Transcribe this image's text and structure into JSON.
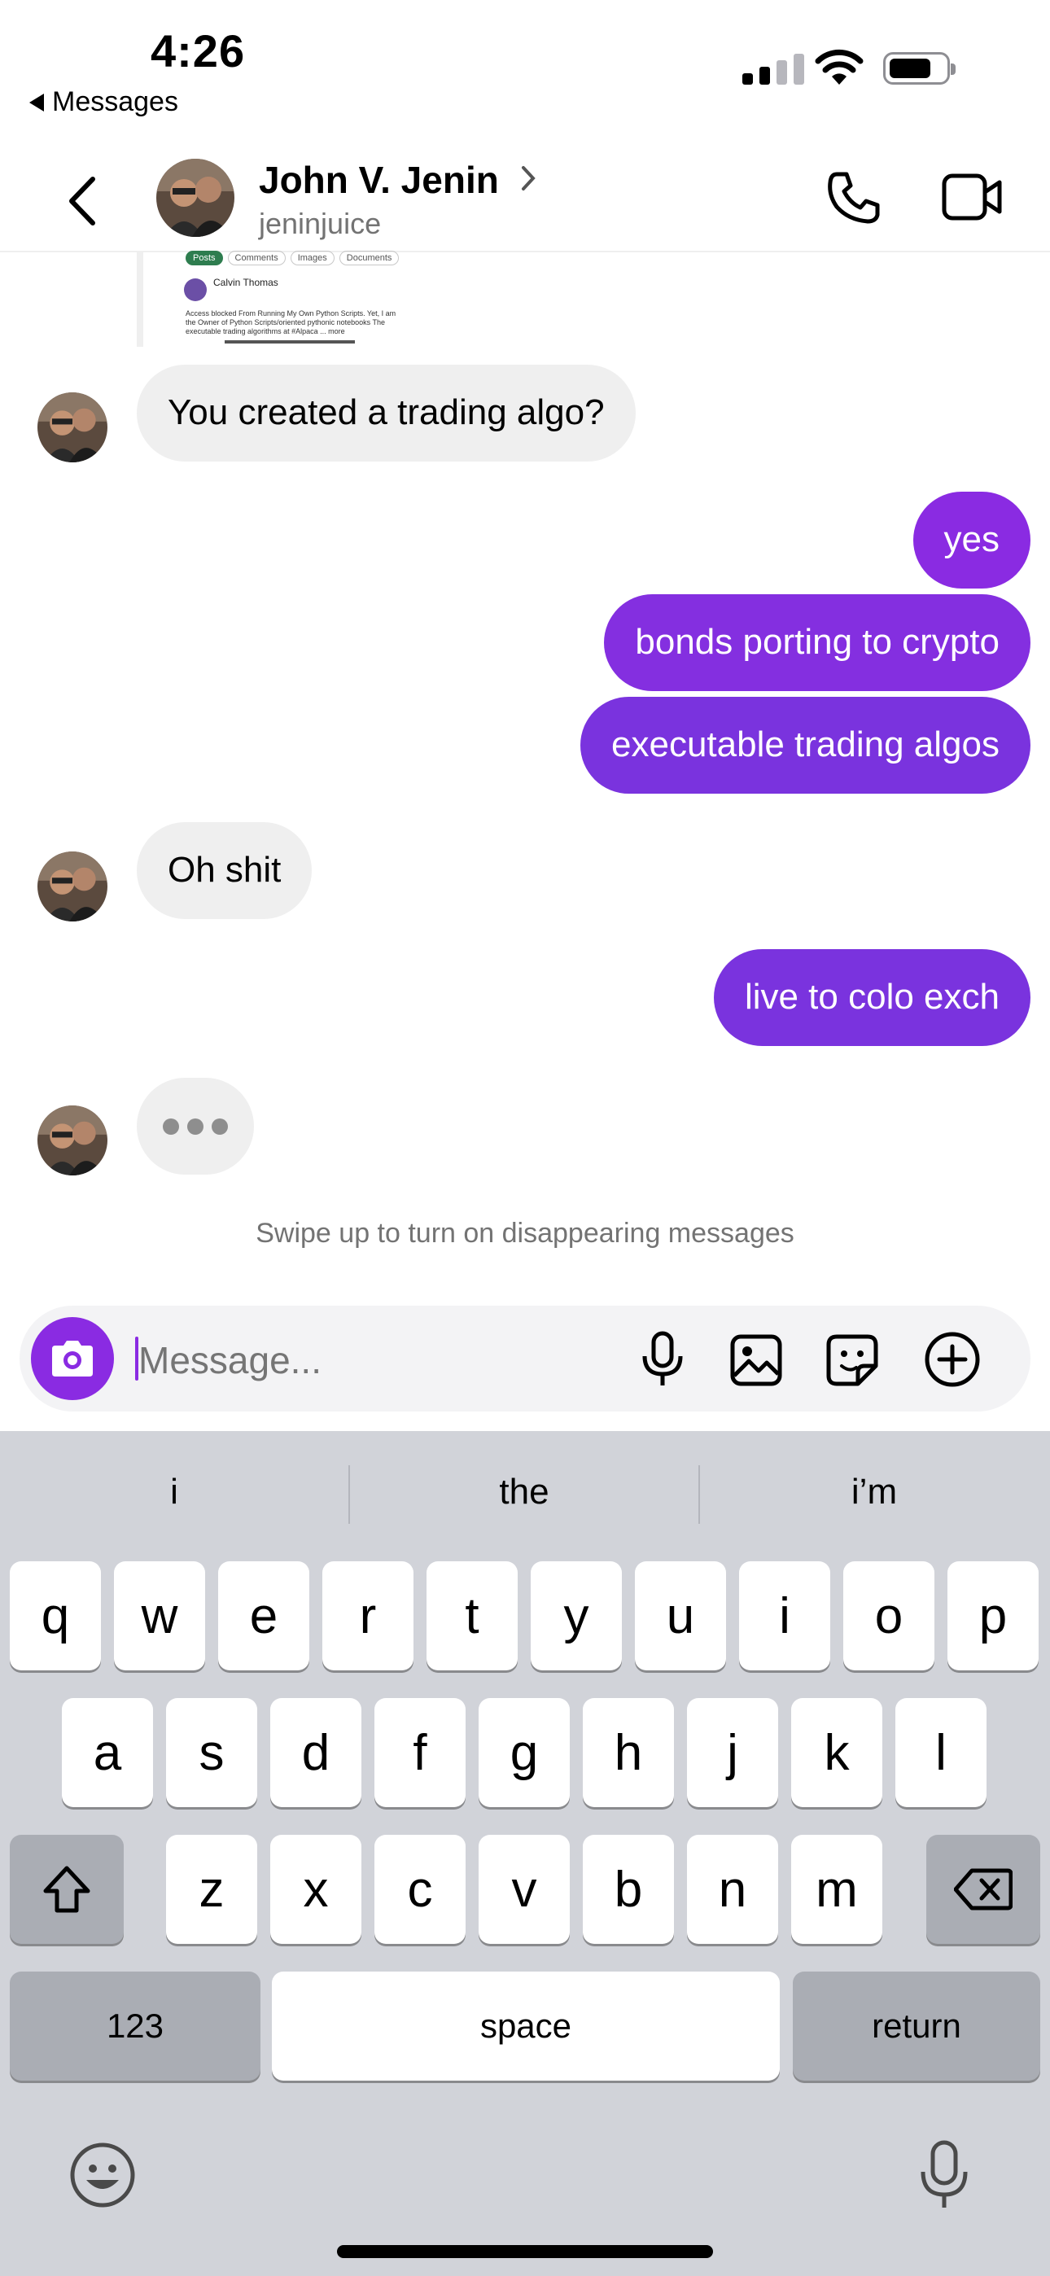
{
  "status_bar": {
    "time": "4:26",
    "back_app": "Messages"
  },
  "header": {
    "name": "John V. Jenin",
    "username": "jeninjuice"
  },
  "shared_post": {
    "tabs": [
      "Posts",
      "Comments",
      "Images",
      "Documents"
    ],
    "author": "Calvin Thomas",
    "body": "Access blocked From Running My Own Python Scripts. Yet, I am the Owner of Python Scripts/oriented pythonic notebooks The executable trading algorithms at #Alpaca ... more"
  },
  "messages": [
    {
      "side": "in",
      "text": "You created a trading algo?"
    },
    {
      "side": "out",
      "text": "yes"
    },
    {
      "side": "out",
      "text": "bonds porting to crypto"
    },
    {
      "side": "out",
      "text": "executable trading algos"
    },
    {
      "side": "in",
      "text": "Oh shit"
    },
    {
      "side": "out",
      "text": "live to colo exch"
    }
  ],
  "disappearing_hint": "Swipe up to turn on disappearing messages",
  "composer": {
    "placeholder": "Message..."
  },
  "keyboard": {
    "suggestions": [
      "i",
      "the",
      "i’m"
    ],
    "row1": [
      "q",
      "w",
      "e",
      "r",
      "t",
      "y",
      "u",
      "i",
      "o",
      "p"
    ],
    "row2": [
      "a",
      "s",
      "d",
      "f",
      "g",
      "h",
      "j",
      "k",
      "l"
    ],
    "row3": [
      "z",
      "x",
      "c",
      "v",
      "b",
      "n",
      "m"
    ],
    "numbers_key": "123",
    "space_key": "space",
    "return_key": "return"
  },
  "colors": {
    "accent": "#8a2be2",
    "incoming_bubble": "#efefef",
    "keyboard_bg": "#d1d3d9"
  }
}
